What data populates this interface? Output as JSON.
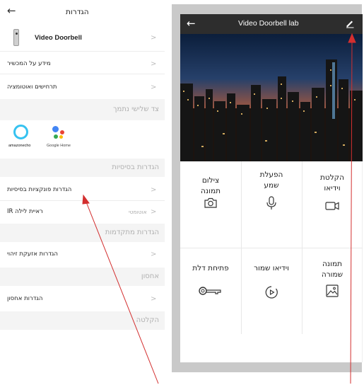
{
  "left_panel": {
    "header": {
      "back_icon": "back-arrow-icon",
      "title": "הגדרות"
    },
    "device": {
      "name": "Video Doorbell",
      "icon": "doorbell-device-icon"
    },
    "rows_top": [
      {
        "label": "מידע על המכשיר"
      },
      {
        "label": "תרחישים ואוטומציה"
      }
    ],
    "third_party": {
      "title": "צד שלישי נתמך",
      "items": [
        {
          "label": "amazonecho",
          "icon": "alexa-icon"
        },
        {
          "label": "Google Home",
          "icon": "google-assistant-icon"
        }
      ]
    },
    "basic": {
      "title": "הגדרות בסיסיות",
      "rows": [
        {
          "label": "הגדרות פונקציות בסיסיות",
          "value": ""
        },
        {
          "label": "ראיית לילה IR",
          "value": "אוטומטי"
        }
      ]
    },
    "advanced": {
      "title": "הגדרות מתקדמות",
      "rows": [
        {
          "label": "הגדרות אזעקת זיהוי"
        }
      ]
    },
    "storage": {
      "title": "אחסון",
      "rows": [
        {
          "label": "הגדרות אחסון"
        }
      ]
    },
    "recording": {
      "title": "הקלטה"
    },
    "chevron": ">"
  },
  "phone": {
    "header": {
      "title": "Video Doorbell lab",
      "back_icon": "back-arrow-icon",
      "edit_icon": "pencil-edit-icon"
    },
    "actions": [
      {
        "label": "הקלטת\nוידיאו",
        "icon": "video-record-icon"
      },
      {
        "label": "הפעלת\nשמע",
        "icon": "microphone-icon"
      },
      {
        "label": "צילום\nתמונה",
        "icon": "camera-icon"
      },
      {
        "label": "תמונה\nשמורה",
        "icon": "image-gallery-icon"
      },
      {
        "label": "וידיאו שמור",
        "icon": "saved-video-play-icon"
      },
      {
        "label": "פתיחת דלת",
        "icon": "key-icon"
      }
    ]
  },
  "colors": {
    "header_dark": "#2d2d2d",
    "annotation_arrow": "#d32f2f",
    "section_bg": "#f4f4f4",
    "alexa": "#36c2f0"
  }
}
